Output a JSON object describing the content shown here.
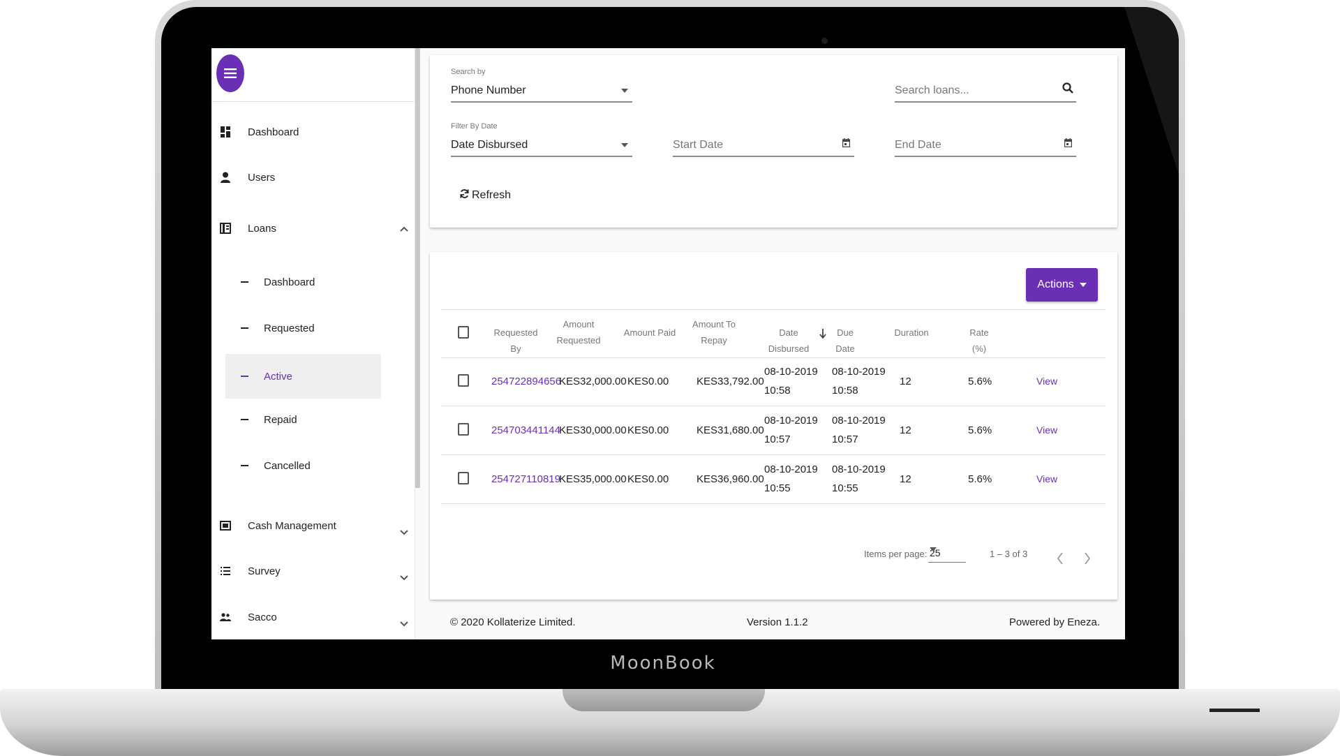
{
  "device": {
    "brand": "MoonBook"
  },
  "sidebar": {
    "items": [
      {
        "label": "Dashboard",
        "icon": "dashboard-icon"
      },
      {
        "label": "Users",
        "icon": "user-icon"
      },
      {
        "label": "Loans",
        "icon": "loans-book-icon",
        "expanded": true
      },
      {
        "label": "Cash Management",
        "icon": "cash-icon"
      },
      {
        "label": "Survey",
        "icon": "list-icon"
      },
      {
        "label": "Sacco",
        "icon": "group-icon"
      }
    ],
    "loan_subitems": [
      {
        "label": "Dashboard"
      },
      {
        "label": "Requested"
      },
      {
        "label": "Active",
        "active": true
      },
      {
        "label": "Repaid"
      },
      {
        "label": "Cancelled"
      }
    ]
  },
  "filters": {
    "search_by_label": "Search by",
    "search_by_value": "Phone Number",
    "search_placeholder": "Search loans...",
    "filter_by_date_label": "Filter By Date",
    "filter_by_date_value": "Date Disbursed",
    "start_date_placeholder": "Start Date",
    "end_date_placeholder": "End Date",
    "refresh_label": "Refresh"
  },
  "table": {
    "actions_label": "Actions",
    "columns": {
      "requested_by": "Requested By",
      "amount_requested_1": "Amount",
      "amount_requested_2": "Requested",
      "amount_paid": "Amount Paid",
      "amount_to_repay_1": "Amount To",
      "amount_to_repay_2": "Repay",
      "date_disbursed": "Date Disbursed",
      "due_date": "Due Date",
      "duration": "Duration",
      "rate": "Rate (%)"
    },
    "rows": [
      {
        "requested_by": "254722894656",
        "amount_requested": "KES32,000.00",
        "amount_paid": "KES0.00",
        "amount_to_repay": "KES33,792.00",
        "date_disbursed_1": "08-10-2019",
        "date_disbursed_2": "10:58",
        "due_date_1": "08-10-2019",
        "due_date_2": "10:58",
        "duration": "12",
        "rate": "5.6%",
        "action": "View"
      },
      {
        "requested_by": "254703441144",
        "amount_requested": "KES30,000.00",
        "amount_paid": "KES0.00",
        "amount_to_repay": "KES31,680.00",
        "date_disbursed_1": "08-10-2019",
        "date_disbursed_2": "10:57",
        "due_date_1": "08-10-2019",
        "due_date_2": "10:57",
        "duration": "12",
        "rate": "5.6%",
        "action": "View"
      },
      {
        "requested_by": "254727110819",
        "amount_requested": "KES35,000.00",
        "amount_paid": "KES0.00",
        "amount_to_repay": "KES36,960.00",
        "date_disbursed_1": "08-10-2019",
        "date_disbursed_2": "10:55",
        "due_date_1": "08-10-2019",
        "due_date_2": "10:55",
        "duration": "12",
        "rate": "5.6%",
        "action": "View"
      }
    ],
    "pager": {
      "items_per_page_label": "Items per page:",
      "items_per_page": "25",
      "range": "1 – 3 of 3"
    }
  },
  "footer": {
    "copyright": "© 2020 Kollaterize Limited.",
    "version": "Version 1.1.2",
    "powered_by": "Powered by Eneza."
  },
  "colors": {
    "accent": "#6b2fb5",
    "active_bg": "#efefef"
  }
}
